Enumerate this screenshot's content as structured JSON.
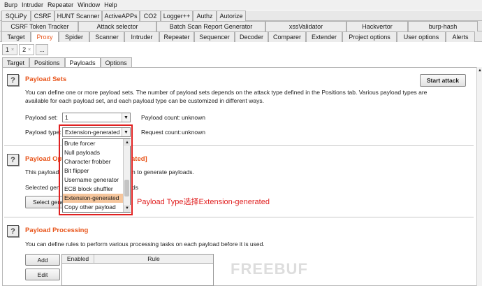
{
  "menu": [
    "Burp",
    "Intruder",
    "Repeater",
    "Window",
    "Help"
  ],
  "tabs_row1": [
    "SQLiPy",
    "CSRF",
    "HUNT Scanner",
    "ActiveAPPs",
    "CO2",
    "Logger++",
    "Authz",
    "Autorize"
  ],
  "tabs_row2": [
    "CSRF Token Tracker",
    "Attack selector",
    "Batch Scan Report Generator",
    "xssValidator",
    "Hackvertor",
    "burp-hash"
  ],
  "tabs_row3": [
    "Target",
    "Proxy",
    "Spider",
    "Scanner",
    "Intruder",
    "Repeater",
    "Sequencer",
    "Decoder",
    "Comparer",
    "Extender",
    "Project options",
    "User options",
    "Alerts"
  ],
  "active_main_tab": "Proxy",
  "attack_tabs": [
    "1",
    "2",
    "..."
  ],
  "intruder_tabs": [
    "Target",
    "Positions",
    "Payloads",
    "Options"
  ],
  "active_intruder_tab": "Payloads",
  "payload_sets": {
    "title": "Payload Sets",
    "desc_line1": "You can define one or more payload sets. The number of payload sets depends on the attack type defined in the Positions tab. Various payload types are",
    "desc_line2": "available for each payload set, and each payload type can be customized in different ways.",
    "set_label": "Payload set:",
    "set_value": "1",
    "count_label": "Payload count:",
    "count_value": "unknown",
    "type_label": "Payload type:",
    "type_value": "Extension-generated",
    "request_label": "Request count:",
    "request_value": "unknown",
    "start_attack": "Start attack"
  },
  "payload_options": {
    "title_start": "Payload Opt",
    "title_end": "ated]",
    "desc_start": "This payload",
    "desc_end": "n to generate payloads.",
    "selected_start": "Selected gen",
    "selected_end": "ds",
    "select_btn": "Select gene"
  },
  "dropdown_items": [
    "Brute forcer",
    "Null payloads",
    "Character frobber",
    "Bit flipper",
    "Username generator",
    "ECB block shuffler",
    "Extension-generated",
    "Copy other payload"
  ],
  "dropdown_selected_index": 6,
  "annotation": "Payload Type选择Extension-generated",
  "payload_processing": {
    "title": "Payload Processing",
    "desc": "You can define rules to perform various processing tasks on each payload before it is used.",
    "add_btn": "Add",
    "edit_btn": "Edit",
    "col_enabled": "Enabled",
    "col_rule": "Rule"
  },
  "watermark": "FREEBUF",
  "help_glyph": "?",
  "colors": {
    "accent": "#e8541a",
    "annotation": "#e02020",
    "selection": "#f5c59c"
  }
}
